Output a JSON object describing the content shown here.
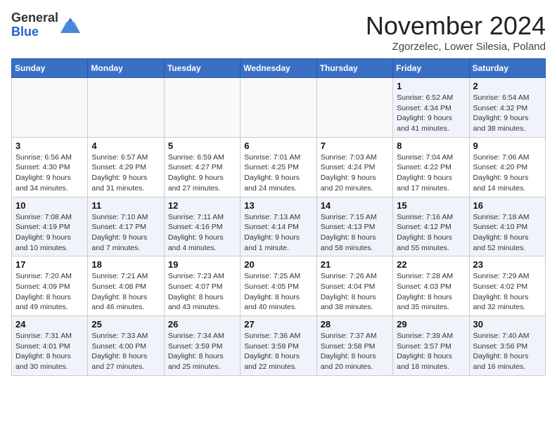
{
  "header": {
    "logo_line1": "General",
    "logo_line2": "Blue",
    "month": "November 2024",
    "location": "Zgorzelec, Lower Silesia, Poland"
  },
  "weekdays": [
    "Sunday",
    "Monday",
    "Tuesday",
    "Wednesday",
    "Thursday",
    "Friday",
    "Saturday"
  ],
  "weeks": [
    [
      {
        "day": "",
        "info": ""
      },
      {
        "day": "",
        "info": ""
      },
      {
        "day": "",
        "info": ""
      },
      {
        "day": "",
        "info": ""
      },
      {
        "day": "",
        "info": ""
      },
      {
        "day": "1",
        "info": "Sunrise: 6:52 AM\nSunset: 4:34 PM\nDaylight: 9 hours\nand 41 minutes."
      },
      {
        "day": "2",
        "info": "Sunrise: 6:54 AM\nSunset: 4:32 PM\nDaylight: 9 hours\nand 38 minutes."
      }
    ],
    [
      {
        "day": "3",
        "info": "Sunrise: 6:56 AM\nSunset: 4:30 PM\nDaylight: 9 hours\nand 34 minutes."
      },
      {
        "day": "4",
        "info": "Sunrise: 6:57 AM\nSunset: 4:29 PM\nDaylight: 9 hours\nand 31 minutes."
      },
      {
        "day": "5",
        "info": "Sunrise: 6:59 AM\nSunset: 4:27 PM\nDaylight: 9 hours\nand 27 minutes."
      },
      {
        "day": "6",
        "info": "Sunrise: 7:01 AM\nSunset: 4:25 PM\nDaylight: 9 hours\nand 24 minutes."
      },
      {
        "day": "7",
        "info": "Sunrise: 7:03 AM\nSunset: 4:24 PM\nDaylight: 9 hours\nand 20 minutes."
      },
      {
        "day": "8",
        "info": "Sunrise: 7:04 AM\nSunset: 4:22 PM\nDaylight: 9 hours\nand 17 minutes."
      },
      {
        "day": "9",
        "info": "Sunrise: 7:06 AM\nSunset: 4:20 PM\nDaylight: 9 hours\nand 14 minutes."
      }
    ],
    [
      {
        "day": "10",
        "info": "Sunrise: 7:08 AM\nSunset: 4:19 PM\nDaylight: 9 hours\nand 10 minutes."
      },
      {
        "day": "11",
        "info": "Sunrise: 7:10 AM\nSunset: 4:17 PM\nDaylight: 9 hours\nand 7 minutes."
      },
      {
        "day": "12",
        "info": "Sunrise: 7:11 AM\nSunset: 4:16 PM\nDaylight: 9 hours\nand 4 minutes."
      },
      {
        "day": "13",
        "info": "Sunrise: 7:13 AM\nSunset: 4:14 PM\nDaylight: 9 hours\nand 1 minute."
      },
      {
        "day": "14",
        "info": "Sunrise: 7:15 AM\nSunset: 4:13 PM\nDaylight: 8 hours\nand 58 minutes."
      },
      {
        "day": "15",
        "info": "Sunrise: 7:16 AM\nSunset: 4:12 PM\nDaylight: 8 hours\nand 55 minutes."
      },
      {
        "day": "16",
        "info": "Sunrise: 7:18 AM\nSunset: 4:10 PM\nDaylight: 8 hours\nand 52 minutes."
      }
    ],
    [
      {
        "day": "17",
        "info": "Sunrise: 7:20 AM\nSunset: 4:09 PM\nDaylight: 8 hours\nand 49 minutes."
      },
      {
        "day": "18",
        "info": "Sunrise: 7:21 AM\nSunset: 4:08 PM\nDaylight: 8 hours\nand 46 minutes."
      },
      {
        "day": "19",
        "info": "Sunrise: 7:23 AM\nSunset: 4:07 PM\nDaylight: 8 hours\nand 43 minutes."
      },
      {
        "day": "20",
        "info": "Sunrise: 7:25 AM\nSunset: 4:05 PM\nDaylight: 8 hours\nand 40 minutes."
      },
      {
        "day": "21",
        "info": "Sunrise: 7:26 AM\nSunset: 4:04 PM\nDaylight: 8 hours\nand 38 minutes."
      },
      {
        "day": "22",
        "info": "Sunrise: 7:28 AM\nSunset: 4:03 PM\nDaylight: 8 hours\nand 35 minutes."
      },
      {
        "day": "23",
        "info": "Sunrise: 7:29 AM\nSunset: 4:02 PM\nDaylight: 8 hours\nand 32 minutes."
      }
    ],
    [
      {
        "day": "24",
        "info": "Sunrise: 7:31 AM\nSunset: 4:01 PM\nDaylight: 8 hours\nand 30 minutes."
      },
      {
        "day": "25",
        "info": "Sunrise: 7:33 AM\nSunset: 4:00 PM\nDaylight: 8 hours\nand 27 minutes."
      },
      {
        "day": "26",
        "info": "Sunrise: 7:34 AM\nSunset: 3:59 PM\nDaylight: 8 hours\nand 25 minutes."
      },
      {
        "day": "27",
        "info": "Sunrise: 7:36 AM\nSunset: 3:59 PM\nDaylight: 8 hours\nand 22 minutes."
      },
      {
        "day": "28",
        "info": "Sunrise: 7:37 AM\nSunset: 3:58 PM\nDaylight: 8 hours\nand 20 minutes."
      },
      {
        "day": "29",
        "info": "Sunrise: 7:39 AM\nSunset: 3:57 PM\nDaylight: 8 hours\nand 18 minutes."
      },
      {
        "day": "30",
        "info": "Sunrise: 7:40 AM\nSunset: 3:56 PM\nDaylight: 8 hours\nand 16 minutes."
      }
    ]
  ]
}
